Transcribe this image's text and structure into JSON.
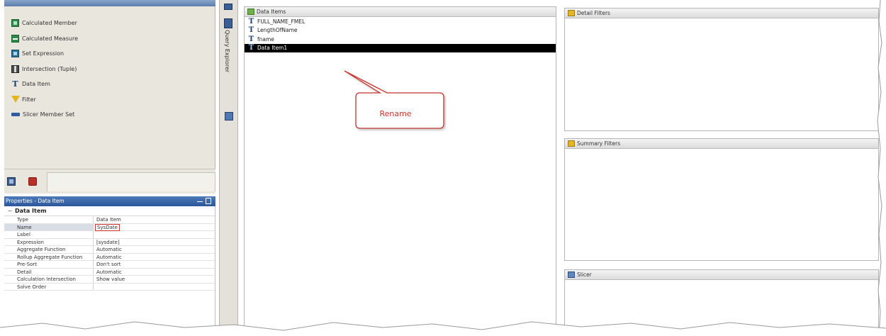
{
  "toolbox": {
    "items": [
      {
        "label": "Calculated Member",
        "icon": "calculated-member-icon"
      },
      {
        "label": "Calculated Measure",
        "icon": "calculated-measure-icon"
      },
      {
        "label": "Set Expression",
        "icon": "set-expression-icon"
      },
      {
        "label": "Intersection (Tuple)",
        "icon": "intersection-icon"
      },
      {
        "label": "Data Item",
        "icon": "data-item-icon"
      },
      {
        "label": "Filter",
        "icon": "filter-icon"
      },
      {
        "label": "Slicer Member Set",
        "icon": "slicer-member-set-icon"
      }
    ]
  },
  "side_strip": {
    "label": "Query Explorer"
  },
  "properties": {
    "title": "Properties - Data Item",
    "group": "Data Item",
    "rows": [
      {
        "key": "Type",
        "value": "Data Item"
      },
      {
        "key": "Name",
        "value": "SysDate"
      },
      {
        "key": "Label",
        "value": ""
      },
      {
        "key": "Expression",
        "value": "[sysdate]"
      },
      {
        "key": "Aggregate Function",
        "value": "Automatic"
      },
      {
        "key": "Rollup Aggregate Function",
        "value": "Automatic"
      },
      {
        "key": "Pre-Sort",
        "value": "Don't sort"
      },
      {
        "key": "Detail",
        "value": "Automatic"
      },
      {
        "key": "Calculation Intersection",
        "value": "Show value"
      },
      {
        "key": "Solve Order",
        "value": ""
      }
    ]
  },
  "data_items": {
    "title": "Data Items",
    "items": [
      {
        "label": "FULL_NAME_FMEL",
        "selected": false
      },
      {
        "label": "LengthOfName",
        "selected": false
      },
      {
        "label": "fname",
        "selected": false
      },
      {
        "label": "Data Item1",
        "selected": true
      }
    ]
  },
  "callout": {
    "text": "Rename",
    "color": "#c7332b"
  },
  "filters": {
    "detail_title": "Detail Filters",
    "summary_title": "Summary Filters",
    "slicer_title": "Slicer"
  }
}
